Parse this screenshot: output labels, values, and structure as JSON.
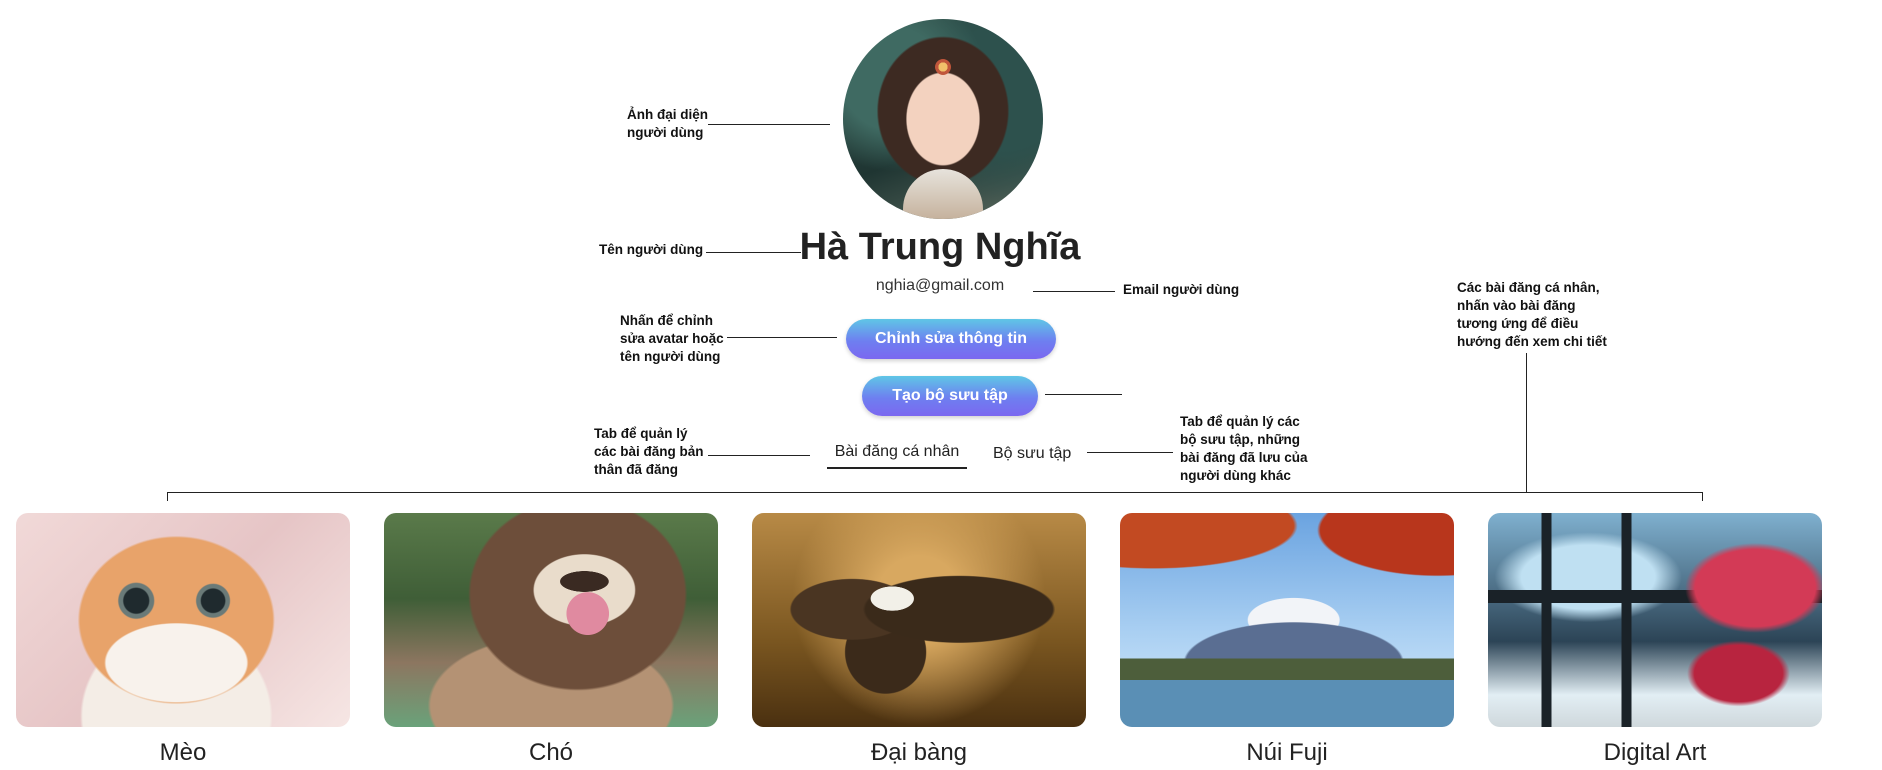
{
  "profile": {
    "name": "Hà Trung Nghĩa",
    "email": "nghia@gmail.com",
    "edit_button": "Chỉnh sửa thông tin",
    "create_collection_button": "Tạo bộ sưu tập"
  },
  "tabs": [
    {
      "label": "Bài đăng cá nhân",
      "active": true
    },
    {
      "label": "Bộ sưu tập",
      "active": false
    }
  ],
  "annotations": {
    "avatar": [
      "Ảnh đại diện",
      "người dùng"
    ],
    "username": [
      "Tên người dùng"
    ],
    "email": [
      "Email người dùng"
    ],
    "edit": [
      "Nhấn để chỉnh",
      "sửa avatar hoặc",
      "tên người dùng"
    ],
    "personal_tab": [
      "Tab để quản lý",
      "các bài đăng bản",
      "thân đã đăng"
    ],
    "collection_tab": [
      "Tab để quản lý các",
      "bộ sưu tập, những",
      "bài đăng đã lưu của",
      "người dùng khác"
    ],
    "posts": [
      "Các bài đăng cá nhân,",
      "nhấn vào bài đăng",
      "tương ứng để điều",
      "hướng đến xem chi tiết"
    ]
  },
  "posts": [
    {
      "title": "Mèo",
      "image": "cat-photo"
    },
    {
      "title": "Chó",
      "image": "dog-photo"
    },
    {
      "title": "Đại bàng",
      "image": "eagle-photo"
    },
    {
      "title": "Núi Fuji",
      "image": "mount-fuji-photo"
    },
    {
      "title": "Digital Art",
      "image": "digital-art-image"
    }
  ]
}
